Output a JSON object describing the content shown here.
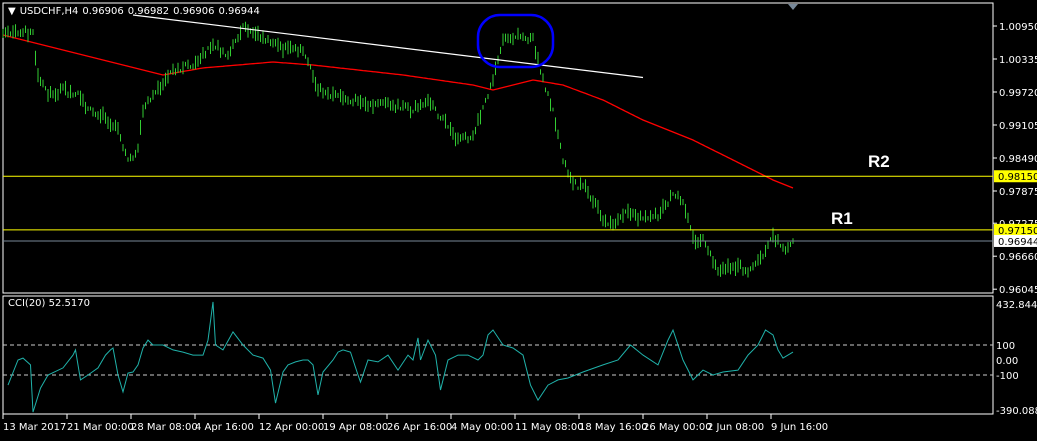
{
  "header": {
    "symbol": "USDCHF,H4",
    "open": "0.96906",
    "high": "0.96982",
    "low": "0.96906",
    "close": "0.96944"
  },
  "cci_header": {
    "name": "CCI(20)",
    "value": "52.5170"
  },
  "annotations": {
    "r1": "R1",
    "r2": "R2"
  },
  "colors": {
    "bars": "#32cd32",
    "ma": "#ff0000",
    "cci": "#20b2aa",
    "level": "#ffff00",
    "bid": "#778899",
    "trendline": "#ffffff",
    "ellipse": "#0000ff"
  },
  "chart_data": [
    {
      "type": "bar",
      "title": "USDCHF,H4",
      "ylim": [
        0.96045,
        1.0115
      ],
      "y_ticks": [
        "1.00950",
        "1.00335",
        "0.99720",
        "0.99105",
        "0.98490",
        "0.97875",
        "0.97275",
        "0.96660",
        "0.96045"
      ],
      "x_ticks": [
        "13 Mar 2017",
        "21 Mar 00:00",
        "28 Mar 08:00",
        "4 Apr 16:00",
        "12 Apr 00:00",
        "19 Apr 08:00",
        "26 Apr 16:00",
        "4 May 00:00",
        "11 May 08:00",
        "18 May 16:00",
        "26 May 00:00",
        "2 Jun 08:00",
        "9 Jun 16:00"
      ],
      "x_tick_bars": [
        0,
        25.6,
        51.2,
        76.8,
        102.4,
        128,
        153.6,
        179.2,
        204.8,
        230.4,
        256,
        281.6,
        307.2
      ],
      "price_path": [
        [
          0,
          1.00782
        ],
        [
          8,
          1.00875
        ],
        [
          12,
          1.00782
        ],
        [
          14,
          1.00037
        ],
        [
          18,
          0.99664
        ],
        [
          24,
          0.99757
        ],
        [
          30,
          0.99664
        ],
        [
          34,
          0.99385
        ],
        [
          40,
          0.99291
        ],
        [
          46,
          0.99012
        ],
        [
          50,
          0.98453
        ],
        [
          54,
          0.9864
        ],
        [
          56,
          0.99385
        ],
        [
          60,
          0.99664
        ],
        [
          64,
          0.9985
        ],
        [
          68,
          1.0013
        ],
        [
          76,
          1.00223
        ],
        [
          84,
          1.00596
        ],
        [
          90,
          1.0041
        ],
        [
          96,
          1.00969
        ],
        [
          102,
          1.00782
        ],
        [
          108,
          1.00596
        ],
        [
          114,
          1.00503
        ],
        [
          120,
          1.00503
        ],
        [
          126,
          0.99757
        ],
        [
          132,
          0.99664
        ],
        [
          140,
          0.99571
        ],
        [
          148,
          0.99478
        ],
        [
          156,
          0.99478
        ],
        [
          164,
          0.99385
        ],
        [
          170,
          0.99571
        ],
        [
          176,
          0.99198
        ],
        [
          182,
          0.98825
        ],
        [
          188,
          0.98919
        ],
        [
          192,
          0.99385
        ],
        [
          196,
          0.99944
        ],
        [
          200,
          1.00689
        ],
        [
          206,
          1.00782
        ],
        [
          212,
          1.00689
        ],
        [
          216,
          0.99944
        ],
        [
          220,
          0.99385
        ],
        [
          224,
          0.98453
        ],
        [
          228,
          0.97987
        ],
        [
          232,
          0.97987
        ],
        [
          236,
          0.97707
        ],
        [
          240,
          0.97335
        ],
        [
          244,
          0.97241
        ],
        [
          250,
          0.97521
        ],
        [
          256,
          0.97335
        ],
        [
          262,
          0.97428
        ],
        [
          268,
          0.97801
        ],
        [
          272,
          0.97707
        ],
        [
          276,
          0.96962
        ],
        [
          280,
          0.96962
        ],
        [
          286,
          0.96403
        ],
        [
          292,
          0.96496
        ],
        [
          298,
          0.96403
        ],
        [
          304,
          0.96682
        ],
        [
          308,
          0.97055
        ],
        [
          312,
          0.96776
        ],
        [
          316,
          0.96925
        ]
      ],
      "moving_average": [
        [
          0,
          1.00782
        ],
        [
          64,
          1.00037
        ],
        [
          80,
          1.00168
        ],
        [
          108,
          1.00279
        ],
        [
          124,
          1.00223
        ],
        [
          160,
          1.00037
        ],
        [
          188,
          0.9985
        ],
        [
          196,
          0.99757
        ],
        [
          212,
          0.99944
        ],
        [
          224,
          0.9985
        ],
        [
          240,
          0.99571
        ],
        [
          256,
          0.99198
        ],
        [
          276,
          0.98825
        ],
        [
          292,
          0.98453
        ],
        [
          308,
          0.9808
        ],
        [
          316,
          0.97931
        ]
      ],
      "levels": [
        {
          "name": "R2",
          "price": "0.98150"
        },
        {
          "name": "R1",
          "price": "0.97150"
        },
        {
          "name": "bid",
          "price": "0.96944"
        }
      ],
      "objects": {
        "trendline": [
          [
            52,
            1.01155
          ],
          [
            256,
            0.9999
          ]
        ],
        "ellipse": {
          "bars": [
            190,
            220
          ],
          "prices": [
            1.01155,
            1.00186
          ]
        }
      }
    },
    {
      "type": "line",
      "title": "CCI(20)",
      "ylim": [
        -390.0885,
        432.8441
      ],
      "y_ticks": [
        "432.8441",
        "100",
        "0.00",
        "-100",
        "-390.0885"
      ],
      "levels": [
        100,
        -100
      ],
      "series": [
        [
          2,
          -167
        ],
        [
          6,
          0
        ],
        [
          8,
          13
        ],
        [
          11,
          -33
        ],
        [
          12,
          -347
        ],
        [
          15,
          -187
        ],
        [
          18,
          -100
        ],
        [
          24,
          -53
        ],
        [
          28,
          33
        ],
        [
          29,
          67
        ],
        [
          31,
          -133
        ],
        [
          34,
          -100
        ],
        [
          38,
          -53
        ],
        [
          41,
          33
        ],
        [
          43,
          67
        ],
        [
          44,
          80
        ],
        [
          46,
          -100
        ],
        [
          48,
          -213
        ],
        [
          50,
          -87
        ],
        [
          52,
          -80
        ],
        [
          54,
          -33
        ],
        [
          56,
          80
        ],
        [
          58,
          133
        ],
        [
          60,
          100
        ],
        [
          64,
          100
        ],
        [
          68,
          67
        ],
        [
          72,
          53
        ],
        [
          76,
          33
        ],
        [
          80,
          33
        ],
        [
          82,
          133
        ],
        [
          84,
          387
        ],
        [
          85,
          100
        ],
        [
          88,
          67
        ],
        [
          92,
          187
        ],
        [
          96,
          100
        ],
        [
          100,
          33
        ],
        [
          104,
          13
        ],
        [
          107,
          -67
        ],
        [
          109,
          -287
        ],
        [
          112,
          -80
        ],
        [
          114,
          -33
        ],
        [
          117,
          -13
        ],
        [
          120,
          0
        ],
        [
          122,
          0
        ],
        [
          124,
          -33
        ],
        [
          126,
          -233
        ],
        [
          128,
          -80
        ],
        [
          132,
          0
        ],
        [
          134,
          53
        ],
        [
          136,
          67
        ],
        [
          139,
          53
        ],
        [
          142,
          -100
        ],
        [
          143,
          -147
        ],
        [
          146,
          0
        ],
        [
          150,
          -13
        ],
        [
          154,
          33
        ],
        [
          158,
          -67
        ],
        [
          162,
          33
        ],
        [
          164,
          0
        ],
        [
          166,
          147
        ],
        [
          167,
          0
        ],
        [
          170,
          133
        ],
        [
          173,
          33
        ],
        [
          175,
          -200
        ],
        [
          178,
          0
        ],
        [
          182,
          33
        ],
        [
          186,
          33
        ],
        [
          190,
          0
        ],
        [
          192,
          33
        ],
        [
          194,
          167
        ],
        [
          196,
          200
        ],
        [
          200,
          100
        ],
        [
          204,
          80
        ],
        [
          208,
          33
        ],
        [
          211,
          -167
        ],
        [
          214,
          -267
        ],
        [
          218,
          -167
        ],
        [
          222,
          -133
        ],
        [
          226,
          -120
        ],
        [
          232,
          -80
        ],
        [
          240,
          -33
        ],
        [
          246,
          0
        ],
        [
          251,
          100
        ],
        [
          256,
          33
        ],
        [
          262,
          -33
        ],
        [
          266,
          133
        ],
        [
          268,
          200
        ],
        [
          272,
          0
        ],
        [
          276,
          -133
        ],
        [
          280,
          -67
        ],
        [
          284,
          -100
        ],
        [
          288,
          -80
        ],
        [
          294,
          -67
        ],
        [
          298,
          33
        ],
        [
          302,
          100
        ],
        [
          305,
          200
        ],
        [
          308,
          167
        ],
        [
          310,
          67
        ],
        [
          312,
          13
        ],
        [
          316,
          53
        ]
      ]
    }
  ]
}
